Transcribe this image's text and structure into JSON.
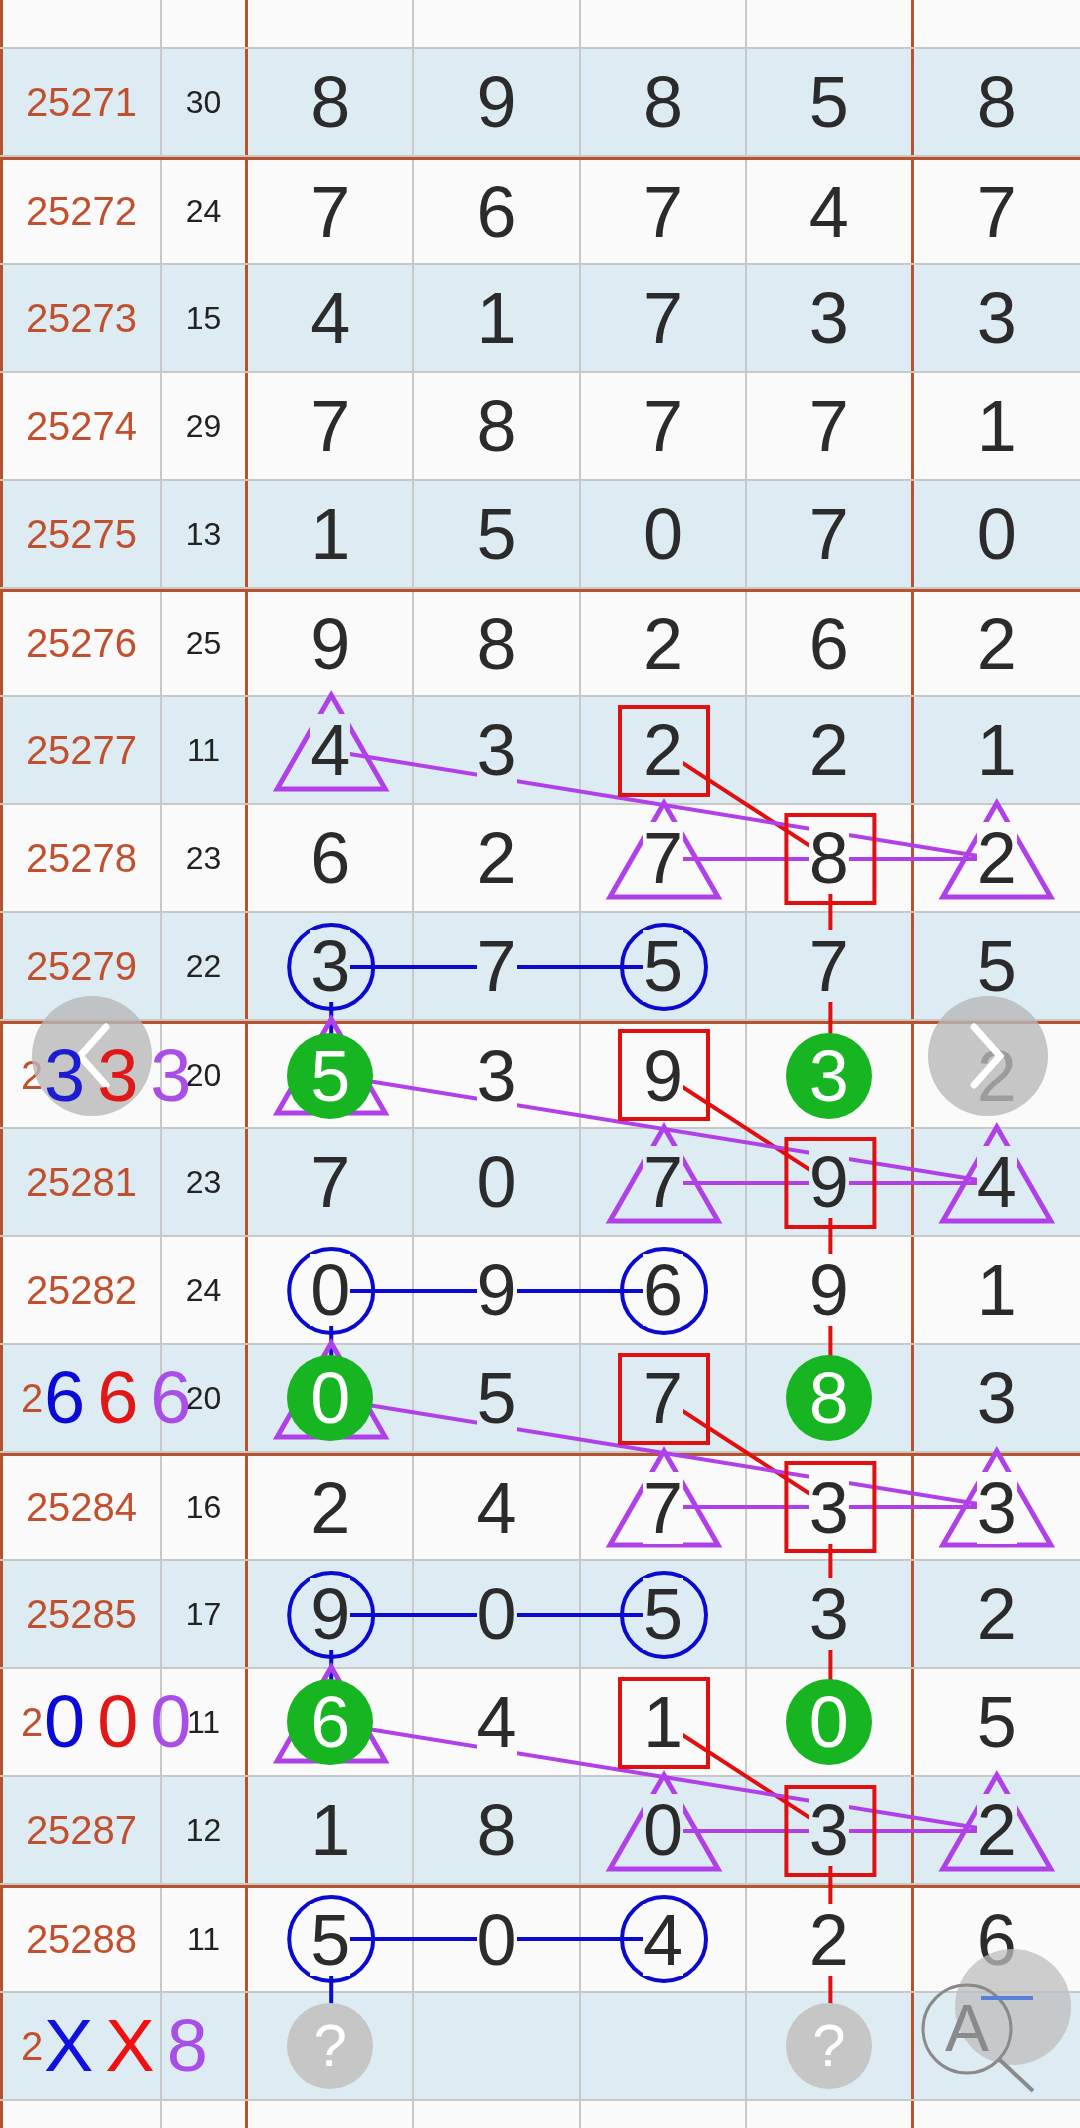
{
  "rows": [
    {
      "issue": "25271",
      "sum": "30",
      "shaded": true,
      "group_start": false,
      "cells": [
        {
          "digit": "8"
        },
        {
          "digit": "9"
        },
        {
          "digit": "8"
        },
        {
          "digit": "5"
        },
        {
          "digit": "8"
        }
      ]
    },
    {
      "issue": "25272",
      "sum": "24",
      "shaded": false,
      "group_start": true,
      "cells": [
        {
          "digit": "7"
        },
        {
          "digit": "6"
        },
        {
          "digit": "7"
        },
        {
          "digit": "4"
        },
        {
          "digit": "7"
        }
      ]
    },
    {
      "issue": "25273",
      "sum": "15",
      "shaded": true,
      "group_start": false,
      "cells": [
        {
          "digit": "4"
        },
        {
          "digit": "1"
        },
        {
          "digit": "7"
        },
        {
          "digit": "3"
        },
        {
          "digit": "3"
        }
      ]
    },
    {
      "issue": "25274",
      "sum": "29",
      "shaded": false,
      "group_start": false,
      "cells": [
        {
          "digit": "7"
        },
        {
          "digit": "8"
        },
        {
          "digit": "7"
        },
        {
          "digit": "7"
        },
        {
          "digit": "1"
        }
      ]
    },
    {
      "issue": "25275",
      "sum": "13",
      "shaded": true,
      "group_start": false,
      "cells": [
        {
          "digit": "1"
        },
        {
          "digit": "5"
        },
        {
          "digit": "0"
        },
        {
          "digit": "7"
        },
        {
          "digit": "0"
        }
      ]
    },
    {
      "issue": "25276",
      "sum": "25",
      "shaded": false,
      "group_start": true,
      "cells": [
        {
          "digit": "9"
        },
        {
          "digit": "8"
        },
        {
          "digit": "2"
        },
        {
          "digit": "6"
        },
        {
          "digit": "2"
        }
      ]
    },
    {
      "issue": "25277",
      "sum": "11",
      "shaded": true,
      "group_start": false,
      "cells": [
        {
          "digit": "4",
          "triangle": true
        },
        {
          "digit": "3"
        },
        {
          "digit": "2",
          "square": true
        },
        {
          "digit": "2"
        },
        {
          "digit": "1"
        }
      ]
    },
    {
      "issue": "25278",
      "sum": "23",
      "shaded": false,
      "group_start": false,
      "cells": [
        {
          "digit": "6"
        },
        {
          "digit": "2"
        },
        {
          "digit": "7",
          "triangle": true
        },
        {
          "digit": "8",
          "square": true
        },
        {
          "digit": "2",
          "triangle": true
        }
      ]
    },
    {
      "issue": "25279",
      "sum": "22",
      "shaded": true,
      "group_start": false,
      "cells": [
        {
          "digit": "3",
          "circle": true
        },
        {
          "digit": "7"
        },
        {
          "digit": "5",
          "circle": true
        },
        {
          "digit": "7"
        },
        {
          "digit": "5"
        }
      ]
    },
    {
      "issue": "2",
      "sum": "20",
      "shaded": false,
      "group_start": true,
      "hint": [
        {
          "text": "3",
          "color": "#1c1cd0"
        },
        {
          "text": "3",
          "color": "#e01818"
        },
        {
          "text": "3",
          "color": "#a94ee6"
        }
      ],
      "cells": [
        {
          "digit": "5",
          "triangle": true,
          "ball": true
        },
        {
          "digit": "3"
        },
        {
          "digit": "9",
          "square": true
        },
        {
          "digit": "3",
          "ball": true
        },
        {
          "digit": "2"
        }
      ]
    },
    {
      "issue": "25281",
      "sum": "23",
      "shaded": true,
      "group_start": false,
      "cells": [
        {
          "digit": "7"
        },
        {
          "digit": "0"
        },
        {
          "digit": "7",
          "triangle": true
        },
        {
          "digit": "9",
          "square": true
        },
        {
          "digit": "4",
          "triangle": true
        }
      ]
    },
    {
      "issue": "25282",
      "sum": "24",
      "shaded": false,
      "group_start": false,
      "cells": [
        {
          "digit": "0",
          "circle": true
        },
        {
          "digit": "9"
        },
        {
          "digit": "6",
          "circle": true
        },
        {
          "digit": "9"
        },
        {
          "digit": "1"
        }
      ]
    },
    {
      "issue": "2",
      "sum": "20",
      "shaded": true,
      "group_start": false,
      "hint": [
        {
          "text": "6",
          "color": "#0a0ad8"
        },
        {
          "text": "6",
          "color": "#e01818"
        },
        {
          "text": "6",
          "color": "#a94ee6"
        }
      ],
      "cells": [
        {
          "digit": "0",
          "triangle": true,
          "ball": true
        },
        {
          "digit": "5"
        },
        {
          "digit": "7",
          "square": true
        },
        {
          "digit": "8",
          "ball": true
        },
        {
          "digit": "3"
        }
      ]
    },
    {
      "issue": "25284",
      "sum": "16",
      "shaded": false,
      "group_start": true,
      "cells": [
        {
          "digit": "2"
        },
        {
          "digit": "4"
        },
        {
          "digit": "7",
          "triangle": true
        },
        {
          "digit": "3",
          "square": true
        },
        {
          "digit": "3",
          "triangle": true
        }
      ]
    },
    {
      "issue": "25285",
      "sum": "17",
      "shaded": true,
      "group_start": false,
      "cells": [
        {
          "digit": "9",
          "circle": true
        },
        {
          "digit": "0"
        },
        {
          "digit": "5",
          "circle": true
        },
        {
          "digit": "3"
        },
        {
          "digit": "2"
        }
      ]
    },
    {
      "issue": "2",
      "sum": "11",
      "shaded": false,
      "group_start": false,
      "hint": [
        {
          "text": "0",
          "color": "#0a0ad8"
        },
        {
          "text": "0",
          "color": "#e01818"
        },
        {
          "text": "0",
          "color": "#a94ee6"
        }
      ],
      "cells": [
        {
          "digit": "6",
          "triangle": true,
          "ball": true
        },
        {
          "digit": "4"
        },
        {
          "digit": "1",
          "square": true
        },
        {
          "digit": "0",
          "ball": true
        },
        {
          "digit": "5"
        }
      ]
    },
    {
      "issue": "25287",
      "sum": "12",
      "shaded": true,
      "group_start": false,
      "cells": [
        {
          "digit": "1"
        },
        {
          "digit": "8"
        },
        {
          "digit": "0",
          "triangle": true
        },
        {
          "digit": "3",
          "square": true
        },
        {
          "digit": "2",
          "triangle": true
        }
      ]
    },
    {
      "issue": "25288",
      "sum": "11",
      "shaded": false,
      "group_start": true,
      "cells": [
        {
          "digit": "5",
          "circle": true
        },
        {
          "digit": "0"
        },
        {
          "digit": "4",
          "circle": true
        },
        {
          "digit": "2"
        },
        {
          "digit": "6"
        }
      ]
    },
    {
      "issue": "2",
      "shaded": true,
      "group_start": false,
      "hint": [
        {
          "text": "X",
          "color": "#1010e0"
        },
        {
          "text": "X",
          "color": "#f01010"
        },
        {
          "text": "8",
          "color": "#a94ee6"
        }
      ],
      "cells": [
        {
          "digit": "?",
          "pending": true
        },
        {},
        {},
        {
          "digit": "?",
          "pending": true
        },
        {}
      ]
    }
  ],
  "zoom_button": {
    "label": "A"
  }
}
